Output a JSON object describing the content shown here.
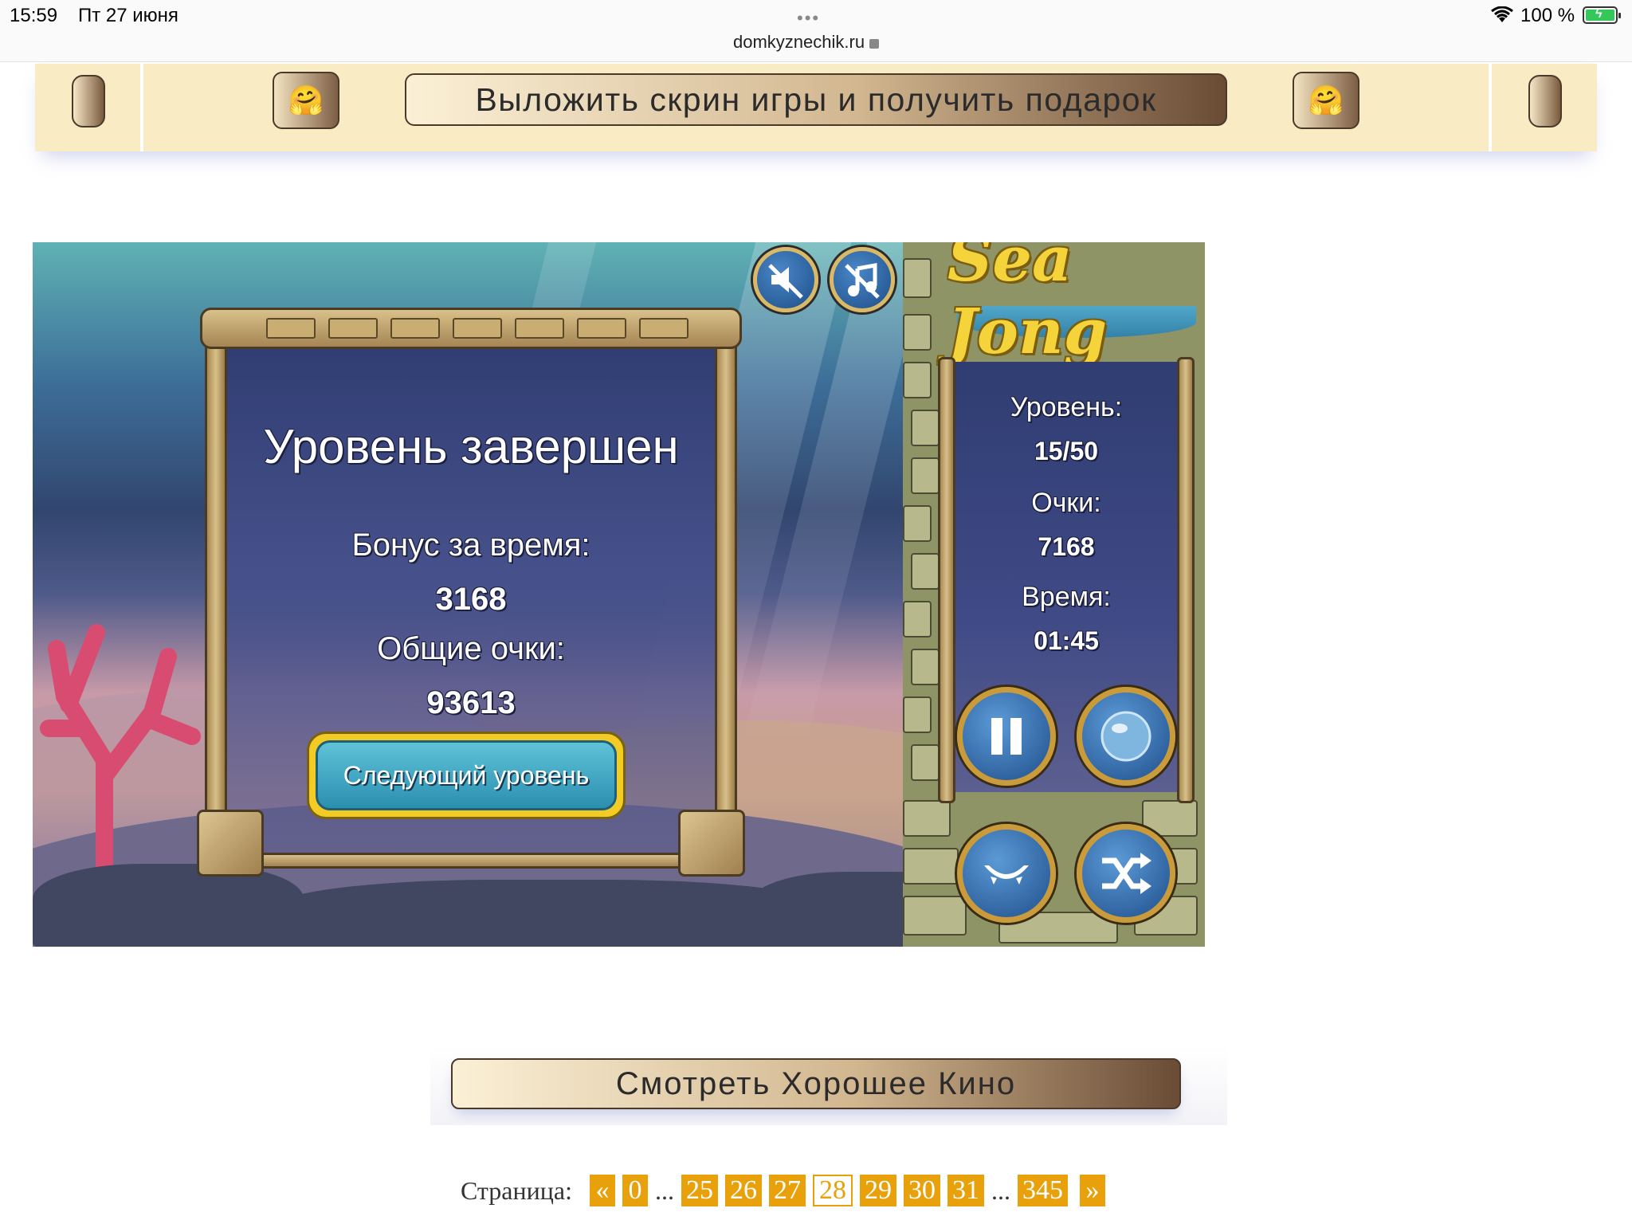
{
  "status_bar": {
    "time": "15:59",
    "date": "Пт 27 июня",
    "dots": "•••",
    "url": "domkyznechik.ru",
    "battery": "100 %"
  },
  "top_banner": {
    "left_emoji": "🤗",
    "right_emoji": "🤗",
    "main_button": "Выложить скрин игры и получить подарок"
  },
  "game": {
    "logo": "Sea Jong",
    "dialog": {
      "title": "Уровень завершен",
      "time_bonus_label": "Бонус за время:",
      "time_bonus_value": "3168",
      "total_label": "Общие очки:",
      "total_value": "93613",
      "next_button": "Следующий уровень"
    },
    "side": {
      "level_label": "Уровень:",
      "level_value": "15/50",
      "score_label": "Очки:",
      "score_value": "7168",
      "time_label": "Время:",
      "time_value": "01:45"
    },
    "icons": [
      "sound-off-icon",
      "music-off-icon",
      "pause-icon",
      "hint-bubble-icon",
      "undo-smile-icon",
      "shuffle-icon"
    ]
  },
  "movie_button": "Смотреть Хорошее Кино",
  "pagination": {
    "label": "Страница:",
    "prev": "«",
    "next": "»",
    "pages": [
      "0",
      "25",
      "26",
      "27",
      "28",
      "29",
      "30",
      "31",
      "345"
    ],
    "ellipsis": "...",
    "current": "28"
  },
  "colors": {
    "banner_bg": "#f9ebc4",
    "pager_orange": "#e8a10a",
    "battery_green": "#34c759"
  }
}
